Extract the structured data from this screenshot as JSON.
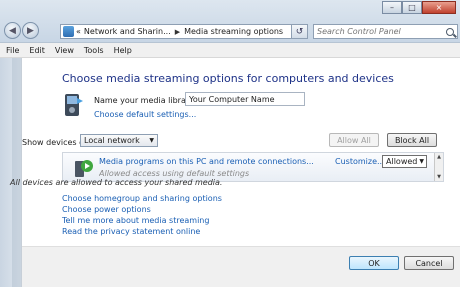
{
  "window": {
    "minimize": "–",
    "maximize": "□",
    "close": "×"
  },
  "address": {
    "prefix": "«",
    "crumb1": "Network and Sharin...",
    "crumb2": "Media streaming options"
  },
  "search": {
    "placeholder": "Search Control Panel"
  },
  "menu": {
    "file": "File",
    "edit": "Edit",
    "view": "View",
    "tools": "Tools",
    "help": "Help"
  },
  "main": {
    "title": "Choose media streaming options for computers and devices",
    "library_label": "Name your media library:",
    "library_value": "Your Computer Name",
    "default_settings_link": "Choose default settings...",
    "show_devices_label": "Show devices on:",
    "show_devices_value": "Local network",
    "allow_all": "Allow All",
    "block_all": "Block All",
    "device": {
      "title": "Media programs on this PC and remote connections...",
      "subtitle": "Allowed access using default settings",
      "customize": "Customize...",
      "status": "Allowed"
    },
    "notice": "All devices are allowed to access your shared media.",
    "links": [
      "Choose homegroup and sharing options",
      "Choose power options",
      "Tell me more about media streaming",
      "Read the privacy statement online"
    ]
  },
  "footer": {
    "ok": "OK",
    "cancel": "Cancel"
  },
  "colors": {
    "title": "#1e3287",
    "link": "#1a5fb4",
    "chrome": "#c8d6e5"
  }
}
